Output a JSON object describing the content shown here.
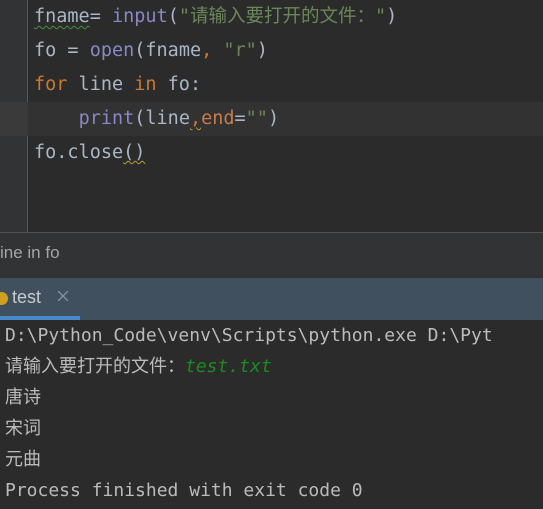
{
  "editor": {
    "lines": [
      {
        "id": "line-1",
        "highlighted": false,
        "tokens": [
          {
            "text": "fname",
            "cls": "tok-default sq-green"
          },
          {
            "text": "= ",
            "cls": "tok-default"
          },
          {
            "text": "input",
            "cls": "tok-func"
          },
          {
            "text": "(",
            "cls": "tok-paren"
          },
          {
            "text": "\"请输入要打开的文件：\"",
            "cls": "tok-string"
          },
          {
            "text": ")",
            "cls": "tok-paren"
          }
        ],
        "plain": "fname= input(\"请输入要打开的文件：\")"
      },
      {
        "id": "line-2",
        "highlighted": false,
        "tokens": [
          {
            "text": "fo = ",
            "cls": "tok-default"
          },
          {
            "text": "open",
            "cls": "tok-func"
          },
          {
            "text": "(fname",
            "cls": "tok-paren"
          },
          {
            "text": ",",
            "cls": "tok-comma"
          },
          {
            "text": " ",
            "cls": "tok-default"
          },
          {
            "text": "\"r\"",
            "cls": "tok-string"
          },
          {
            "text": ")",
            "cls": "tok-paren"
          }
        ],
        "plain": "fo = open(fname, \"r\")"
      },
      {
        "id": "line-3",
        "highlighted": false,
        "tokens": [
          {
            "text": "for",
            "cls": "tok-kw"
          },
          {
            "text": " line ",
            "cls": "tok-default"
          },
          {
            "text": "in",
            "cls": "tok-kw"
          },
          {
            "text": " fo:",
            "cls": "tok-default"
          }
        ],
        "plain": "for line in fo:"
      },
      {
        "id": "line-4",
        "highlighted": true,
        "tokens": [
          {
            "text": "    ",
            "cls": "tok-default"
          },
          {
            "text": "print",
            "cls": "tok-func"
          },
          {
            "text": "(line",
            "cls": "tok-paren"
          },
          {
            "text": ",",
            "cls": "tok-comma sq-yellow"
          },
          {
            "text": "end",
            "cls": "tok-named"
          },
          {
            "text": "=",
            "cls": "tok-default"
          },
          {
            "text": "\"\"",
            "cls": "tok-string"
          },
          {
            "text": ")",
            "cls": "tok-paren"
          }
        ],
        "plain": "    print(line,end=\"\")"
      },
      {
        "id": "line-5",
        "highlighted": false,
        "tokens": [
          {
            "text": "fo.close",
            "cls": "tok-default"
          },
          {
            "text": "()",
            "cls": "tok-paren sq-yellow"
          }
        ],
        "plain": "fo.close()"
      }
    ]
  },
  "breadcrumb": {
    "text": "ine in fo"
  },
  "run_tab": {
    "label": "test",
    "close_icon": "close-icon",
    "status_dot_color": "#cfa020",
    "underline_color": "#4a88c7"
  },
  "console": {
    "lines": [
      {
        "id": "console-line-command",
        "segments": [
          {
            "text": "D:\\Python_Code\\venv\\Scripts\\python.exe D:\\Pyt",
            "cls": ""
          }
        ]
      },
      {
        "id": "console-line-prompt",
        "segments": [
          {
            "text": "请输入要打开的文件：",
            "cls": ""
          },
          {
            "text": "test.txt",
            "cls": "con-input"
          }
        ]
      },
      {
        "id": "console-line-out-1",
        "segments": [
          {
            "text": "唐诗",
            "cls": ""
          }
        ]
      },
      {
        "id": "console-line-out-2",
        "segments": [
          {
            "text": "宋词",
            "cls": ""
          }
        ]
      },
      {
        "id": "console-line-out-3",
        "segments": [
          {
            "text": "元曲",
            "cls": ""
          }
        ]
      },
      {
        "id": "console-line-exit",
        "segments": [
          {
            "text": "Process finished with exit code 0",
            "cls": ""
          }
        ]
      }
    ]
  },
  "colors": {
    "editor_background": "#2b2b2b",
    "gutter_background": "#313335",
    "current_line_highlight": "#323232",
    "tab_background": "#41505f",
    "console_text": "#bbbbbb",
    "string_green": "#6a8759",
    "keyword_orange": "#cc7832",
    "function_violet": "#8888c6"
  }
}
